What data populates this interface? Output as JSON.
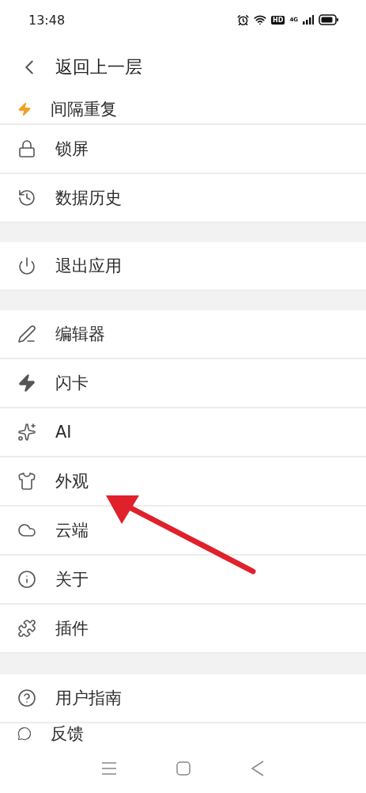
{
  "status_bar": {
    "time": "13:48",
    "hd_badge": "HD",
    "network": "4G"
  },
  "header": {
    "title": "返回上一层"
  },
  "sections": [
    {
      "items": [
        {
          "label": "间隔重复"
        },
        {
          "label": "锁屏"
        },
        {
          "label": "数据历史"
        }
      ]
    },
    {
      "items": [
        {
          "label": "退出应用"
        }
      ]
    },
    {
      "items": [
        {
          "label": "编辑器"
        },
        {
          "label": "闪卡"
        },
        {
          "label": "AI"
        },
        {
          "label": "外观"
        },
        {
          "label": "云端"
        },
        {
          "label": "关于"
        },
        {
          "label": "插件"
        }
      ]
    },
    {
      "items": [
        {
          "label": "用户指南"
        },
        {
          "label": "反馈"
        }
      ]
    }
  ]
}
